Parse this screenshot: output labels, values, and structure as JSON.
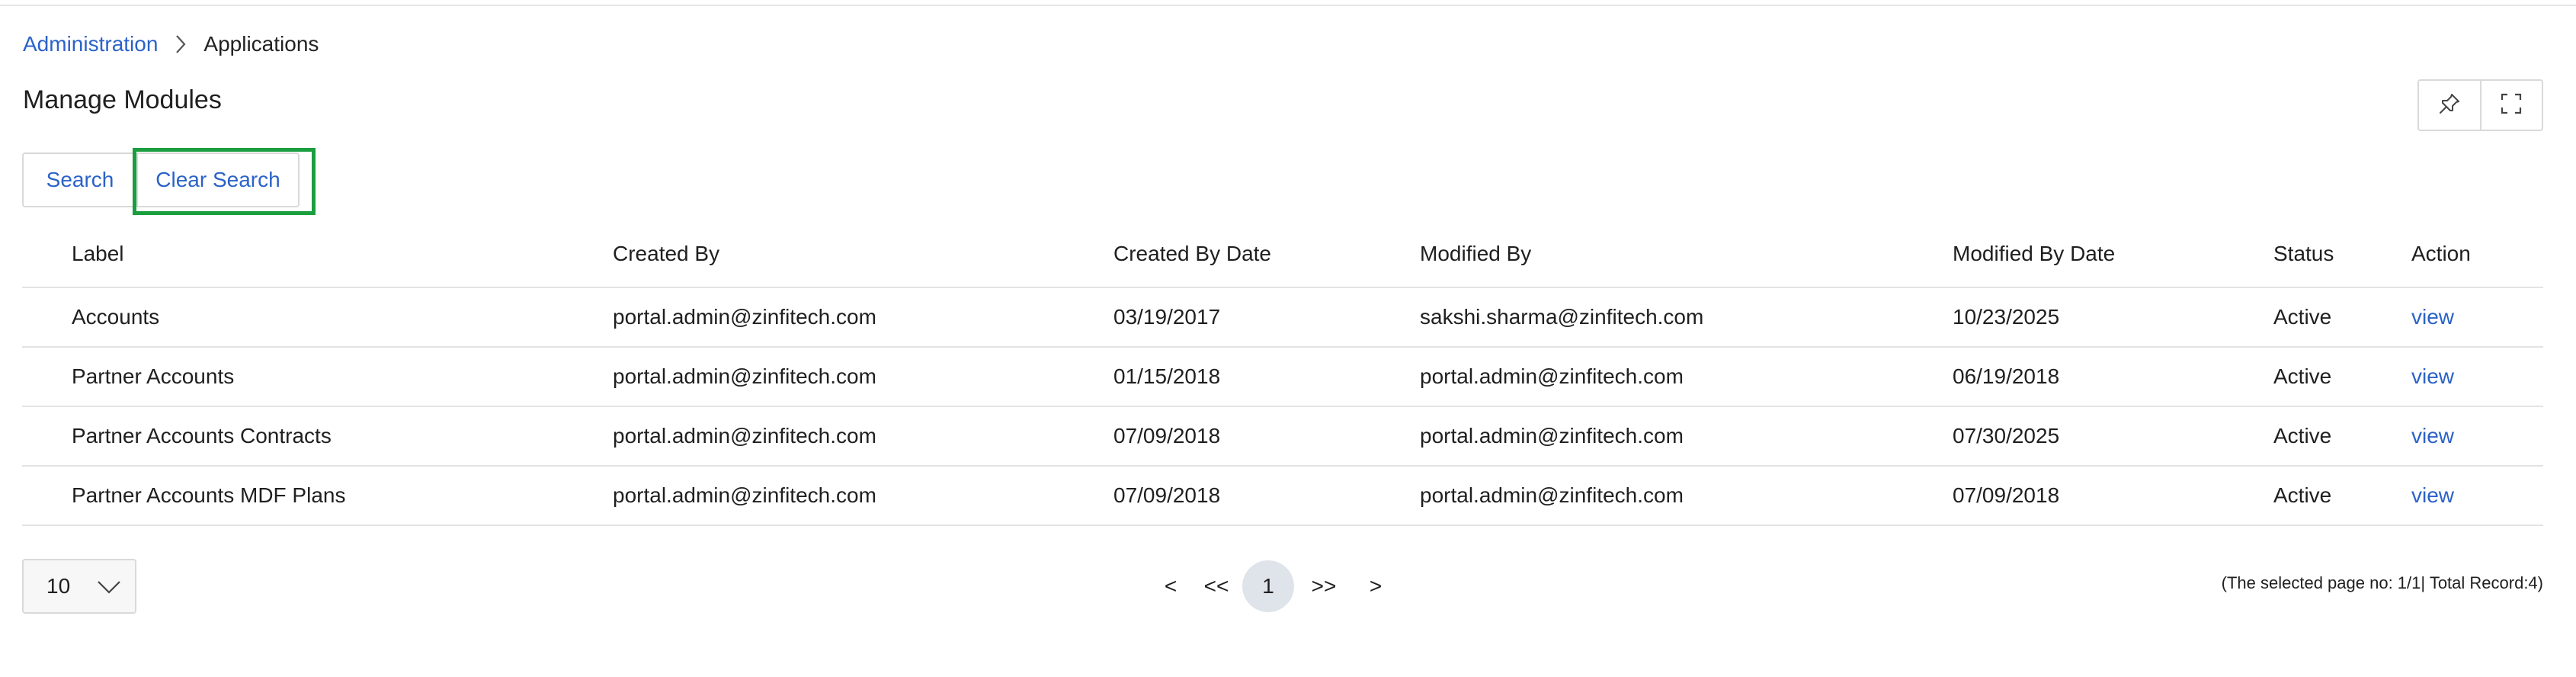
{
  "breadcrumb": {
    "parent": "Administration",
    "current": "Applications"
  },
  "page_title": "Manage Modules",
  "toolbar": {
    "search_label": "Search",
    "clear_search_label": "Clear Search",
    "pin_icon": "pin-icon",
    "fullscreen_icon": "fullscreen-icon"
  },
  "table": {
    "columns": [
      "Label",
      "Created By",
      "Created By Date",
      "Modified By",
      "Modified By Date",
      "Status",
      "Action"
    ],
    "rows": [
      [
        "Accounts",
        "portal.admin@zinfitech.com",
        "03/19/2017",
        "sakshi.sharma@zinfitech.com",
        "10/23/2025",
        "Active",
        "view"
      ],
      [
        "Partner Accounts",
        "portal.admin@zinfitech.com",
        "01/15/2018",
        "portal.admin@zinfitech.com",
        "06/19/2018",
        "Active",
        "view"
      ],
      [
        "Partner Accounts Contracts",
        "portal.admin@zinfitech.com",
        "07/09/2018",
        "portal.admin@zinfitech.com",
        "07/30/2025",
        "Active",
        "view"
      ],
      [
        "Partner Accounts MDF Plans",
        "portal.admin@zinfitech.com",
        "07/09/2018",
        "portal.admin@zinfitech.com",
        "07/09/2018",
        "Active",
        "view"
      ]
    ]
  },
  "pagination": {
    "page_size": "10",
    "prev": "<",
    "first": "<<",
    "current": "1",
    "last": ">>",
    "next": ">",
    "info": "(The selected page no: 1/1| Total Record:4)"
  },
  "colors": {
    "link": "#2b62c8",
    "focus_ring": "#1a9e3f",
    "current_page_bg": "#dfe3ea"
  }
}
